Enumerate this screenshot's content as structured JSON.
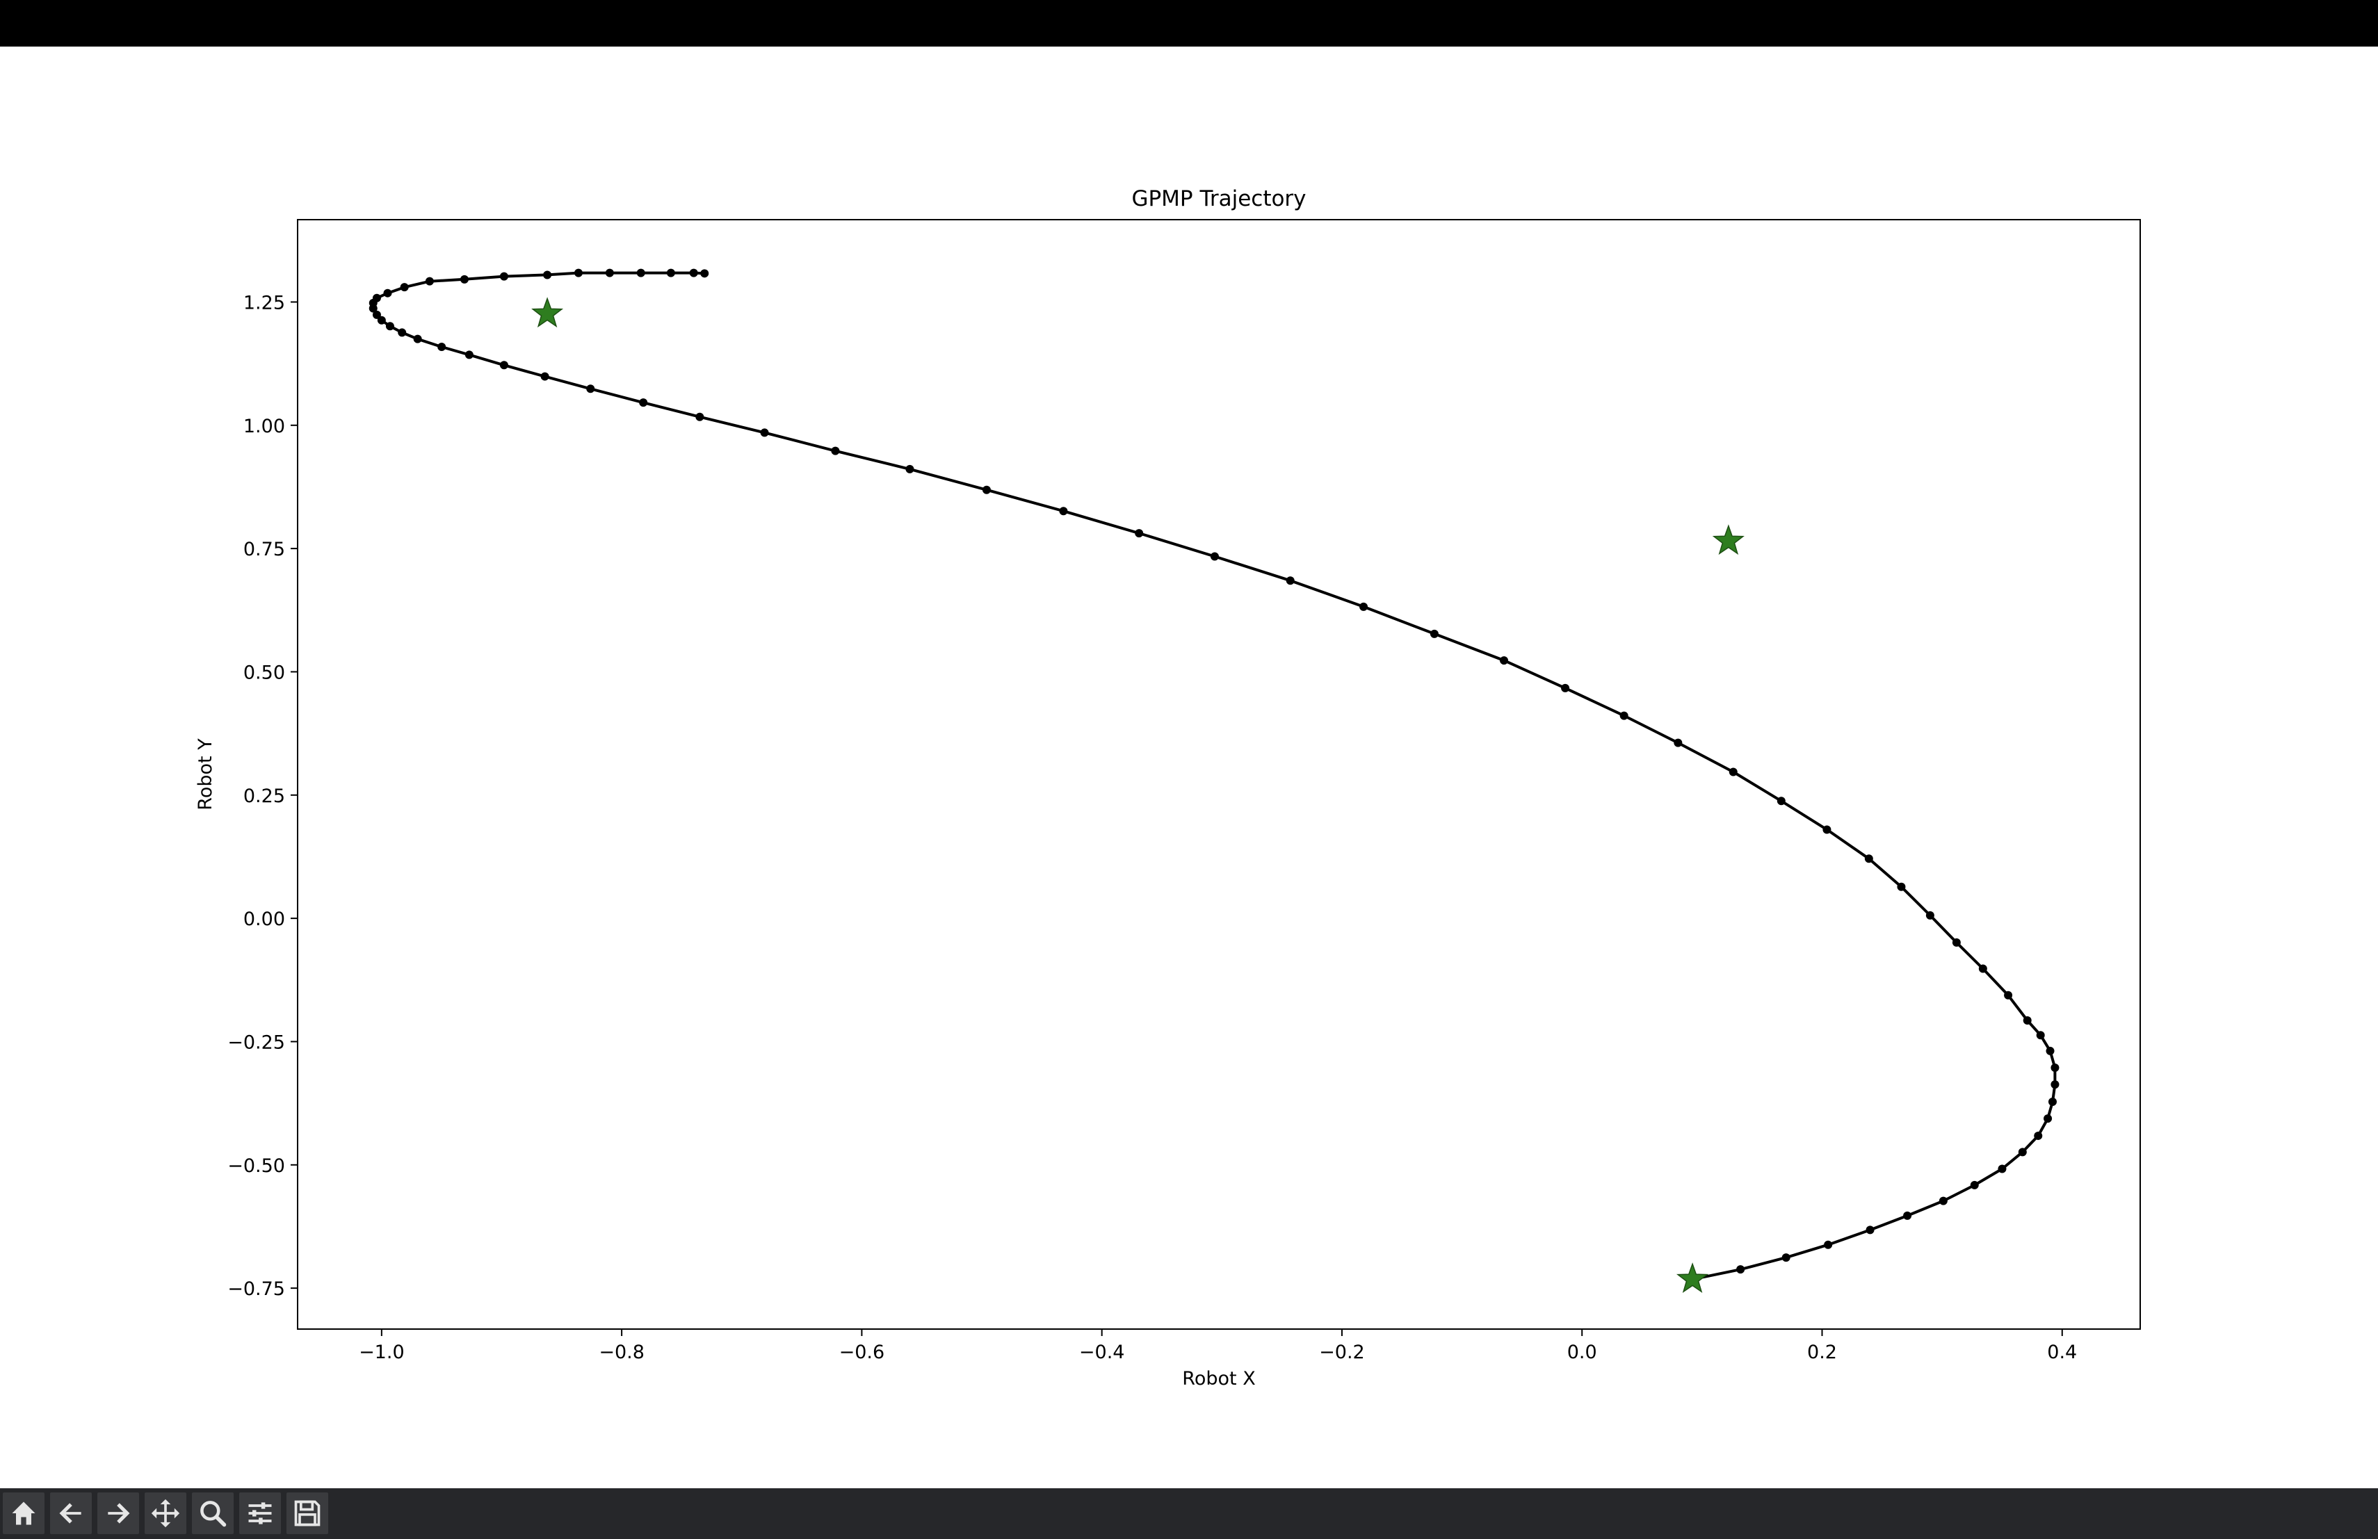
{
  "window": {
    "topbar": ""
  },
  "toolbar": {
    "icons": [
      "home-icon",
      "back-icon",
      "forward-icon",
      "pan-icon",
      "zoom-icon",
      "configure-subplots-icon",
      "save-icon"
    ]
  },
  "chart_data": {
    "type": "line",
    "title": "GPMP Trajectory",
    "xlabel": "Robot X",
    "ylabel": "Robot Y",
    "xlim": [
      -1.07,
      0.465
    ],
    "ylim": [
      -0.833,
      1.417
    ],
    "xticks": [
      -1.0,
      -0.8,
      -0.6,
      -0.4,
      -0.2,
      0.0,
      0.2,
      0.4
    ],
    "xtick_labels": [
      "−1.0",
      "−0.8",
      "−0.6",
      "−0.4",
      "−0.2",
      "0.0",
      "0.2",
      "0.4"
    ],
    "yticks": [
      -0.75,
      -0.5,
      -0.25,
      0.0,
      0.25,
      0.5,
      0.75,
      1.0,
      1.25
    ],
    "ytick_labels": [
      "−0.75",
      "−0.50",
      "−0.25",
      "0.00",
      "0.25",
      "0.50",
      "0.75",
      "1.00",
      "1.25"
    ],
    "grid": false,
    "line_color": "#000000",
    "marker_color": "#000000",
    "star_color": "#2e7d1f",
    "series": [
      {
        "points": [
          [
            0.092,
            -0.732
          ],
          [
            0.132,
            -0.712
          ],
          [
            0.17,
            -0.688
          ],
          [
            0.205,
            -0.662
          ],
          [
            0.24,
            -0.632
          ],
          [
            0.271,
            -0.603
          ],
          [
            0.301,
            -0.573
          ],
          [
            0.327,
            -0.541
          ],
          [
            0.35,
            -0.508
          ],
          [
            0.367,
            -0.474
          ],
          [
            0.38,
            -0.441
          ],
          [
            0.388,
            -0.406
          ],
          [
            0.392,
            -0.372
          ],
          [
            0.394,
            -0.337
          ],
          [
            0.394,
            -0.303
          ],
          [
            0.39,
            -0.269
          ],
          [
            0.382,
            -0.237
          ],
          [
            0.371,
            -0.207
          ],
          [
            0.355,
            -0.156
          ],
          [
            0.334,
            -0.102
          ],
          [
            0.312,
            -0.049
          ],
          [
            0.29,
            0.006
          ],
          [
            0.266,
            0.064
          ],
          [
            0.239,
            0.121
          ],
          [
            0.204,
            0.18
          ],
          [
            0.166,
            0.238
          ],
          [
            0.126,
            0.297
          ],
          [
            0.08,
            0.356
          ],
          [
            0.035,
            0.411
          ],
          [
            -0.014,
            0.467
          ],
          [
            -0.065,
            0.523
          ],
          [
            -0.123,
            0.577
          ],
          [
            -0.182,
            0.632
          ],
          [
            -0.243,
            0.685
          ],
          [
            -0.306,
            0.734
          ],
          [
            -0.369,
            0.781
          ],
          [
            -0.432,
            0.826
          ],
          [
            -0.496,
            0.869
          ],
          [
            -0.56,
            0.911
          ],
          [
            -0.622,
            0.948
          ],
          [
            -0.681,
            0.985
          ],
          [
            -0.735,
            1.017
          ],
          [
            -0.782,
            1.046
          ],
          [
            -0.826,
            1.074
          ],
          [
            -0.864,
            1.099
          ],
          [
            -0.898,
            1.122
          ],
          [
            -0.927,
            1.143
          ],
          [
            -0.95,
            1.159
          ],
          [
            -0.97,
            1.175
          ],
          [
            -0.983,
            1.188
          ],
          [
            -0.993,
            1.201
          ],
          [
            -1.0,
            1.213
          ],
          [
            -1.004,
            1.224
          ],
          [
            -1.007,
            1.237
          ],
          [
            -1.007,
            1.248
          ],
          [
            -1.004,
            1.258
          ],
          [
            -0.995,
            1.268
          ],
          [
            -0.981,
            1.28
          ],
          [
            -0.96,
            1.292
          ],
          [
            -0.931,
            1.296
          ],
          [
            -0.898,
            1.302
          ],
          [
            -0.862,
            1.305
          ],
          [
            -0.836,
            1.309
          ],
          [
            -0.81,
            1.309
          ],
          [
            -0.784,
            1.309
          ],
          [
            -0.759,
            1.309
          ],
          [
            -0.74,
            1.309
          ],
          [
            -0.731,
            1.308
          ]
        ]
      }
    ],
    "stars": [
      [
        0.092,
        -0.732
      ],
      [
        -0.862,
        1.226
      ],
      [
        0.122,
        0.765
      ]
    ]
  }
}
